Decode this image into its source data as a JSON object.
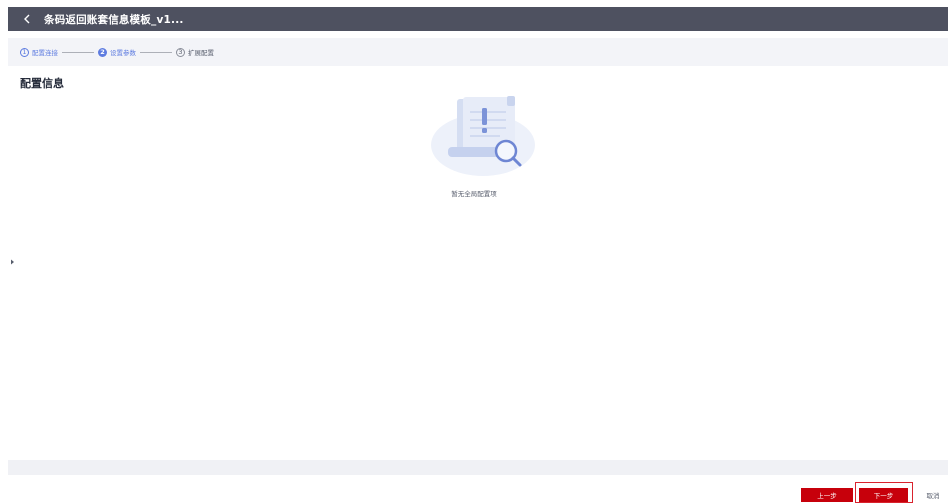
{
  "header": {
    "back_icon": "chevron-left-icon",
    "title": "条码返回账套信息模板_v1..."
  },
  "steps": [
    {
      "number": "1",
      "label": "配置连接",
      "state": "done"
    },
    {
      "number": "2",
      "label": "设置参数",
      "state": "active"
    },
    {
      "number": "3",
      "label": "扩展配置",
      "state": "todo"
    }
  ],
  "section": {
    "title": "配置信息"
  },
  "empty_state": {
    "icon": "empty-document-search-icon",
    "text": "暂无全局配置项"
  },
  "footer": {
    "prev_label": "上一步",
    "next_label": "下一步",
    "cancel_label": "取消"
  },
  "colors": {
    "header_bg": "#4e5160",
    "accent": "#5e7ce0",
    "primary_button": "#c7000b",
    "highlight_border": "#d9232e"
  }
}
